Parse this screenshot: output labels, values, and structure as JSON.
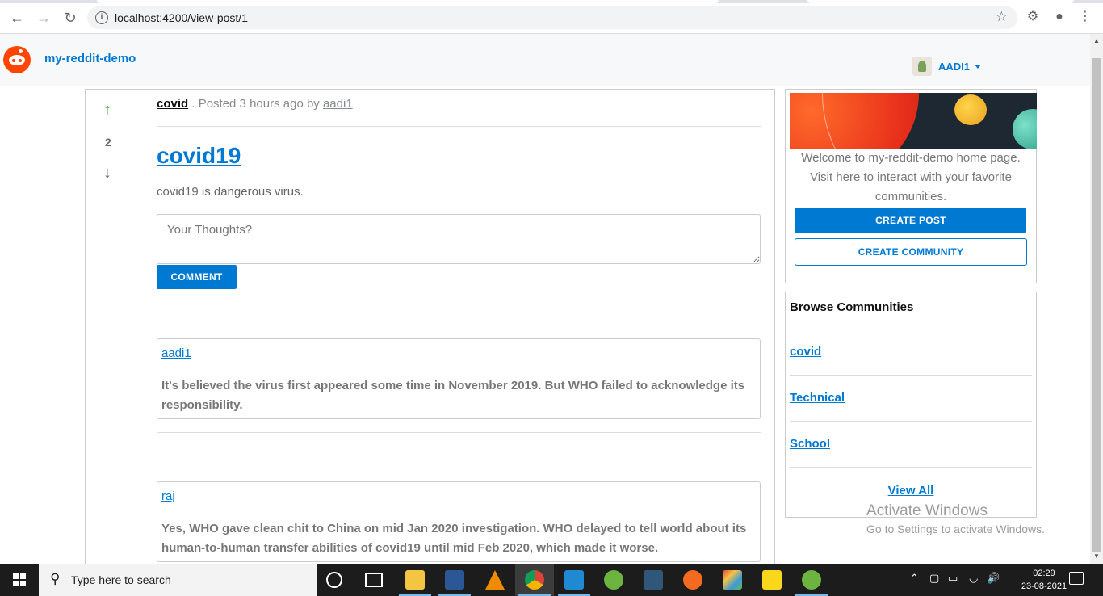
{
  "browser": {
    "url": "localhost:4200/view-post/1"
  },
  "app": {
    "brand": "my-reddit-demo",
    "username": "AADI1"
  },
  "post": {
    "votes": "2",
    "community": "covid",
    "posted_text": ". Posted 3 hours ago by",
    "author": "aadi1",
    "title": "covid19",
    "body": "covid19 is dangerous virus.",
    "comment_placeholder": "Your Thoughts?",
    "comment_button": "COMMENT"
  },
  "comments": [
    {
      "user": "aadi1",
      "text": "It's believed the virus first appeared some time in November 2019. But WHO failed to acknowledge its responsibility."
    },
    {
      "user": "raj",
      "text": "Yes, WHO gave clean chit to China on mid Jan 2020 investigation. WHO delayed to tell world about its human-to-human transfer abilities of covid19 until mid Feb 2020, which made it worse."
    }
  ],
  "sidebar": {
    "welcome": "Welcome to my-reddit-demo home page. Visit here to interact with your favorite communities.",
    "create_post": "CREATE POST",
    "create_community": "CREATE COMMUNITY",
    "browse_title": "Browse Communities",
    "communities": [
      "covid",
      "Technical",
      "School"
    ],
    "view_all": "View All"
  },
  "watermark": {
    "line1": "Activate Windows",
    "line2": "Go to Settings to activate Windows."
  },
  "taskbar": {
    "search_placeholder": "Type here to search",
    "time": "02:29",
    "date": "23-08-2021"
  },
  "colors": {
    "accent": "#0079d3",
    "brand_orange": "#ff4500",
    "upvote": "#0a8a0a"
  }
}
